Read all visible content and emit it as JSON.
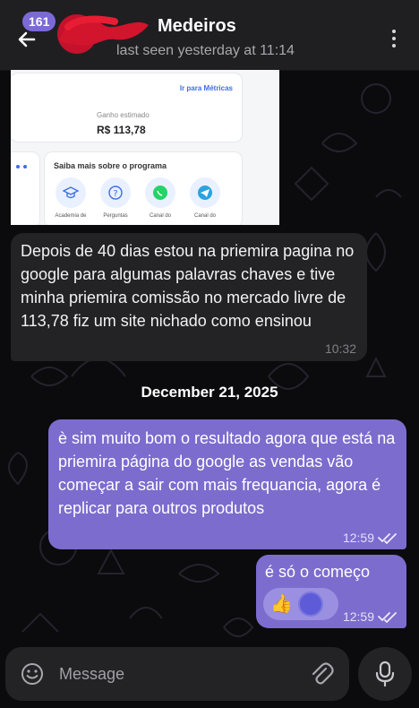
{
  "header": {
    "badge_count": "161",
    "contact_name": "Medeiros",
    "last_seen": "last seen yesterday at 11:14",
    "back_icon": "arrow-left",
    "more_icon": "vertical-dots"
  },
  "shared_image": {
    "metrics_link": "Ir para Métricas",
    "earnings_label": "Ganho estimado",
    "earnings_value": "R$ 113,78",
    "program_title": "Saiba mais sobre o programa",
    "program_items": [
      "Academia de",
      "Perguntas",
      "Canal do",
      "Canal do"
    ]
  },
  "messages": {
    "incoming": {
      "text": "Depois de 40 dias estou na priemira pagina no google para algumas palavras chaves e tive minha priemira comissão no mercado livre de 113,78 fiz um site nichado como ensinou",
      "time": "10:32"
    },
    "date_divider": "December 21, 2025",
    "outgoing_1": {
      "text": "è sim muito bom o resultado agora que está na priemira página do google as vendas vão começar a sair com mais frequancia, agora é replicar para outros produtos",
      "time": "12:59"
    },
    "outgoing_2": {
      "text": "é só o começo",
      "time": "12:59",
      "reaction": "👍"
    }
  },
  "composer": {
    "placeholder": "Message",
    "emoji_icon": "smile",
    "attach_icon": "paperclip",
    "mic_icon": "microphone"
  },
  "colors": {
    "background": "#0b0b0d",
    "header": "#1f1f22",
    "incoming_bubble": "#232326",
    "outgoing_bubble": "#7c6cce",
    "badge": "#7b6ad6"
  }
}
